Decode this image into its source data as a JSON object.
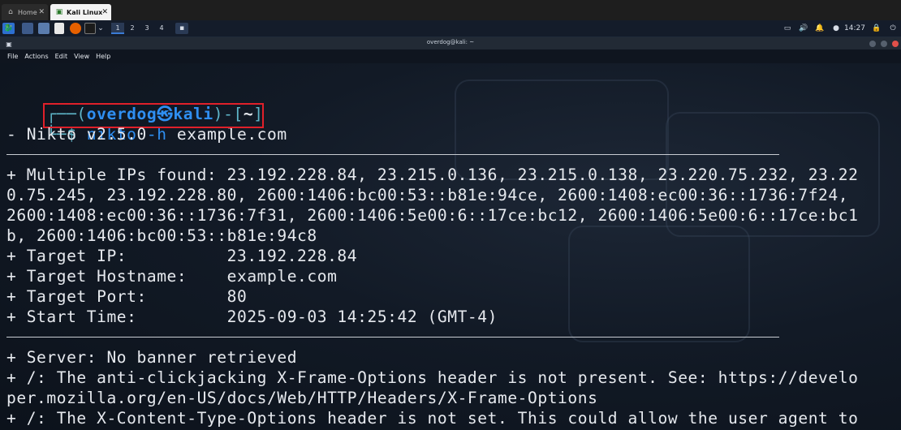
{
  "tabs": [
    {
      "label": "Home",
      "icon": "home-icon"
    },
    {
      "label": "Kali Linux",
      "icon": "vm-icon"
    }
  ],
  "panel": {
    "workspaces": [
      "1",
      "2",
      "3",
      "4"
    ],
    "clock": "14:27"
  },
  "window": {
    "title": "overdog@kali: ~"
  },
  "menu": [
    "File",
    "Actions",
    "Edit",
    "View",
    "Help"
  ],
  "terminal": {
    "prompt_open": "┌──(",
    "user": "overdog",
    "at": "㉿",
    "host": "kali",
    "prompt_close": ")-[",
    "path": "~",
    "prompt_end": "]",
    "prompt_dollar": "└─$ ",
    "command": "nikto",
    "args": " -h ",
    "target": "example.com",
    "lines": [
      "- Nikto v2.5.0",
      "+ Multiple IPs found: 23.192.228.84, 23.215.0.136, 23.215.0.138, 23.220.75.232, 23.22",
      "0.75.245, 23.192.228.80, 2600:1406:bc00:53::b81e:94ce, 2600:1408:ec00:36::1736:7f24,",
      "2600:1408:ec00:36::1736:7f31, 2600:1406:5e00:6::17ce:bc12, 2600:1406:5e00:6::17ce:bc1",
      "b, 2600:1406:bc00:53::b81e:94c8",
      "+ Target IP:          23.192.228.84",
      "+ Target Hostname:    example.com",
      "+ Target Port:        80",
      "+ Start Time:         2025-09-03 14:25:42 (GMT-4)",
      "+ Server: No banner retrieved",
      "+ /: The anti-clickjacking X-Frame-Options header is not present. See: https://develo",
      "per.mozilla.org/en-US/docs/Web/HTTP/Headers/X-Frame-Options",
      "+ /: The X-Content-Type-Options header is not set. This could allow the user agent to"
    ]
  },
  "colors": {
    "accent": "#2f8ff2",
    "highlight_box": "#e0202a"
  }
}
